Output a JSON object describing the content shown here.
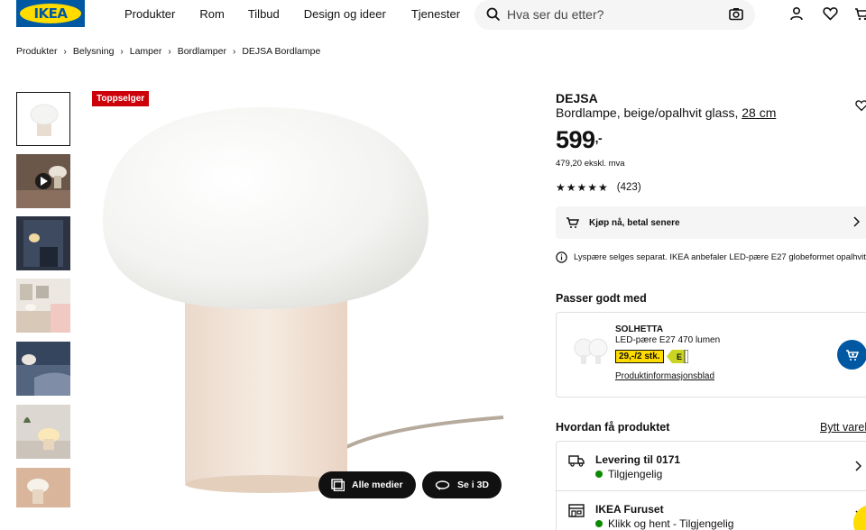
{
  "header": {
    "logo_text": "IKEA",
    "nav": [
      "Produkter",
      "Rom",
      "Tilbud",
      "Design og ideer",
      "Tjenester"
    ],
    "search_placeholder": "Hva ser du etter?"
  },
  "breadcrumb": [
    "Produkter",
    "Belysning",
    "Lamper",
    "Bordlamper",
    "DEJSA Bordlampe"
  ],
  "gallery": {
    "badge": "Toppselger",
    "buttons": {
      "all_media": "Alle medier",
      "view_3d": "Se i 3D"
    }
  },
  "product": {
    "name": "DEJSA",
    "description": "Bordlampe, beige/opalhvit glass,",
    "size_link": "28 cm",
    "price": "599",
    "price_suffix": ",-",
    "price_ex_vat": "479,20 ekskl. mva",
    "rating_count": "(423)",
    "rating_stars": "★★★★★",
    "bnpl": "Kjøp nå, betal senere",
    "info_note": "Lyspære selges separat. IKEA anbefaler LED-pære E27 globeformet opalhvit"
  },
  "recommended": {
    "heading": "Passer godt med",
    "item": {
      "name": "SOLHETTA",
      "desc": "LED-pære E27 470 lumen",
      "price": "29,-/2 stk.",
      "energy_label": "E",
      "link": "Produktinformasjonsblad"
    }
  },
  "delivery": {
    "heading": "Hvordan få produktet",
    "see_all": "Bytt vareh",
    "rows": [
      {
        "title": "Levering til 0171",
        "status": "Tilgjengelig"
      },
      {
        "title": "IKEA Furuset",
        "status": "Klikk og hent - Tilgjengelig"
      }
    ]
  },
  "colors": {
    "ikea_blue": "#0058a3",
    "ikea_yellow": "#ffdb00",
    "badge_red": "#cc0008",
    "available_green": "#0a8a00"
  }
}
